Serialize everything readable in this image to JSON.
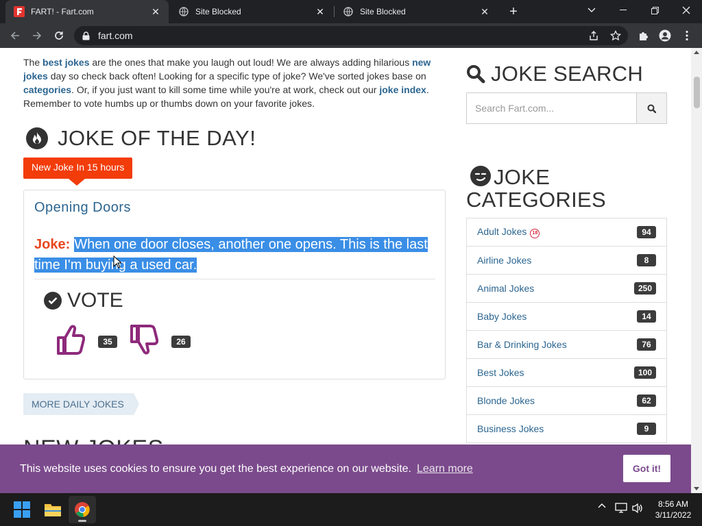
{
  "browser": {
    "tabs": [
      {
        "title": "FART! - Fart.com",
        "active": true
      },
      {
        "title": "Site Blocked",
        "active": false
      },
      {
        "title": "Site Blocked",
        "active": false
      }
    ],
    "url": "fart.com"
  },
  "intro": {
    "p1": "The ",
    "best_jokes": "best jokes",
    "p2": " are the ones that make you laugh out loud! We are always adding hilarious ",
    "new_jokes": "new jokes",
    "p3": " day so check back often! Looking for a specific type of joke?  We've sorted jokes base on ",
    "categories": "categories",
    "p4": ".  Or, if you just want to kill some time while you're at work, check out our ",
    "joke_index": "joke index",
    "p5": ". Remember to vote humbs up or thumbs down on your favorite jokes."
  },
  "jotd": {
    "heading": "JOKE OF THE DAY!",
    "badge": "New Joke In 15 hours",
    "title": "Opening Doors",
    "label": "Joke:",
    "text": "When one door closes, another one opens. This is the last time I'm buying a used car.",
    "vote_heading": "VOTE",
    "thumbs_up_count": "35",
    "thumbs_down_count": "26",
    "more_button": "MORE DAILY JOKES"
  },
  "new_jokes_heading": "NEW JOKES",
  "sidebar": {
    "search_heading": "JOKE SEARCH",
    "search_placeholder": "Search Fart.com...",
    "categories_heading": "JOKE CATEGORIES",
    "categories": [
      {
        "label": "Adult Jokes",
        "count": "94",
        "adult": true
      },
      {
        "label": "Airline Jokes",
        "count": "8"
      },
      {
        "label": "Animal Jokes",
        "count": "250"
      },
      {
        "label": "Baby Jokes",
        "count": "14"
      },
      {
        "label": "Bar & Drinking Jokes",
        "count": "76"
      },
      {
        "label": "Best Jokes",
        "count": "100"
      },
      {
        "label": "Blonde Jokes",
        "count": "62"
      },
      {
        "label": "Business Jokes",
        "count": "9"
      }
    ],
    "adult_mark": "18"
  },
  "cookie": {
    "message": "This website uses cookies to ensure you get the best experience on our website.",
    "learn_more": "Learn more",
    "button": "Got it!"
  },
  "taskbar": {
    "time": "8:56 AM",
    "date": "3/11/2022"
  },
  "colors": {
    "accent_link": "#2b6590",
    "badge_orange": "#f23c0a",
    "selection": "#3a8ee6",
    "vote_purple": "#8e2a7b",
    "cookie_bg": "#7b4a8c"
  }
}
